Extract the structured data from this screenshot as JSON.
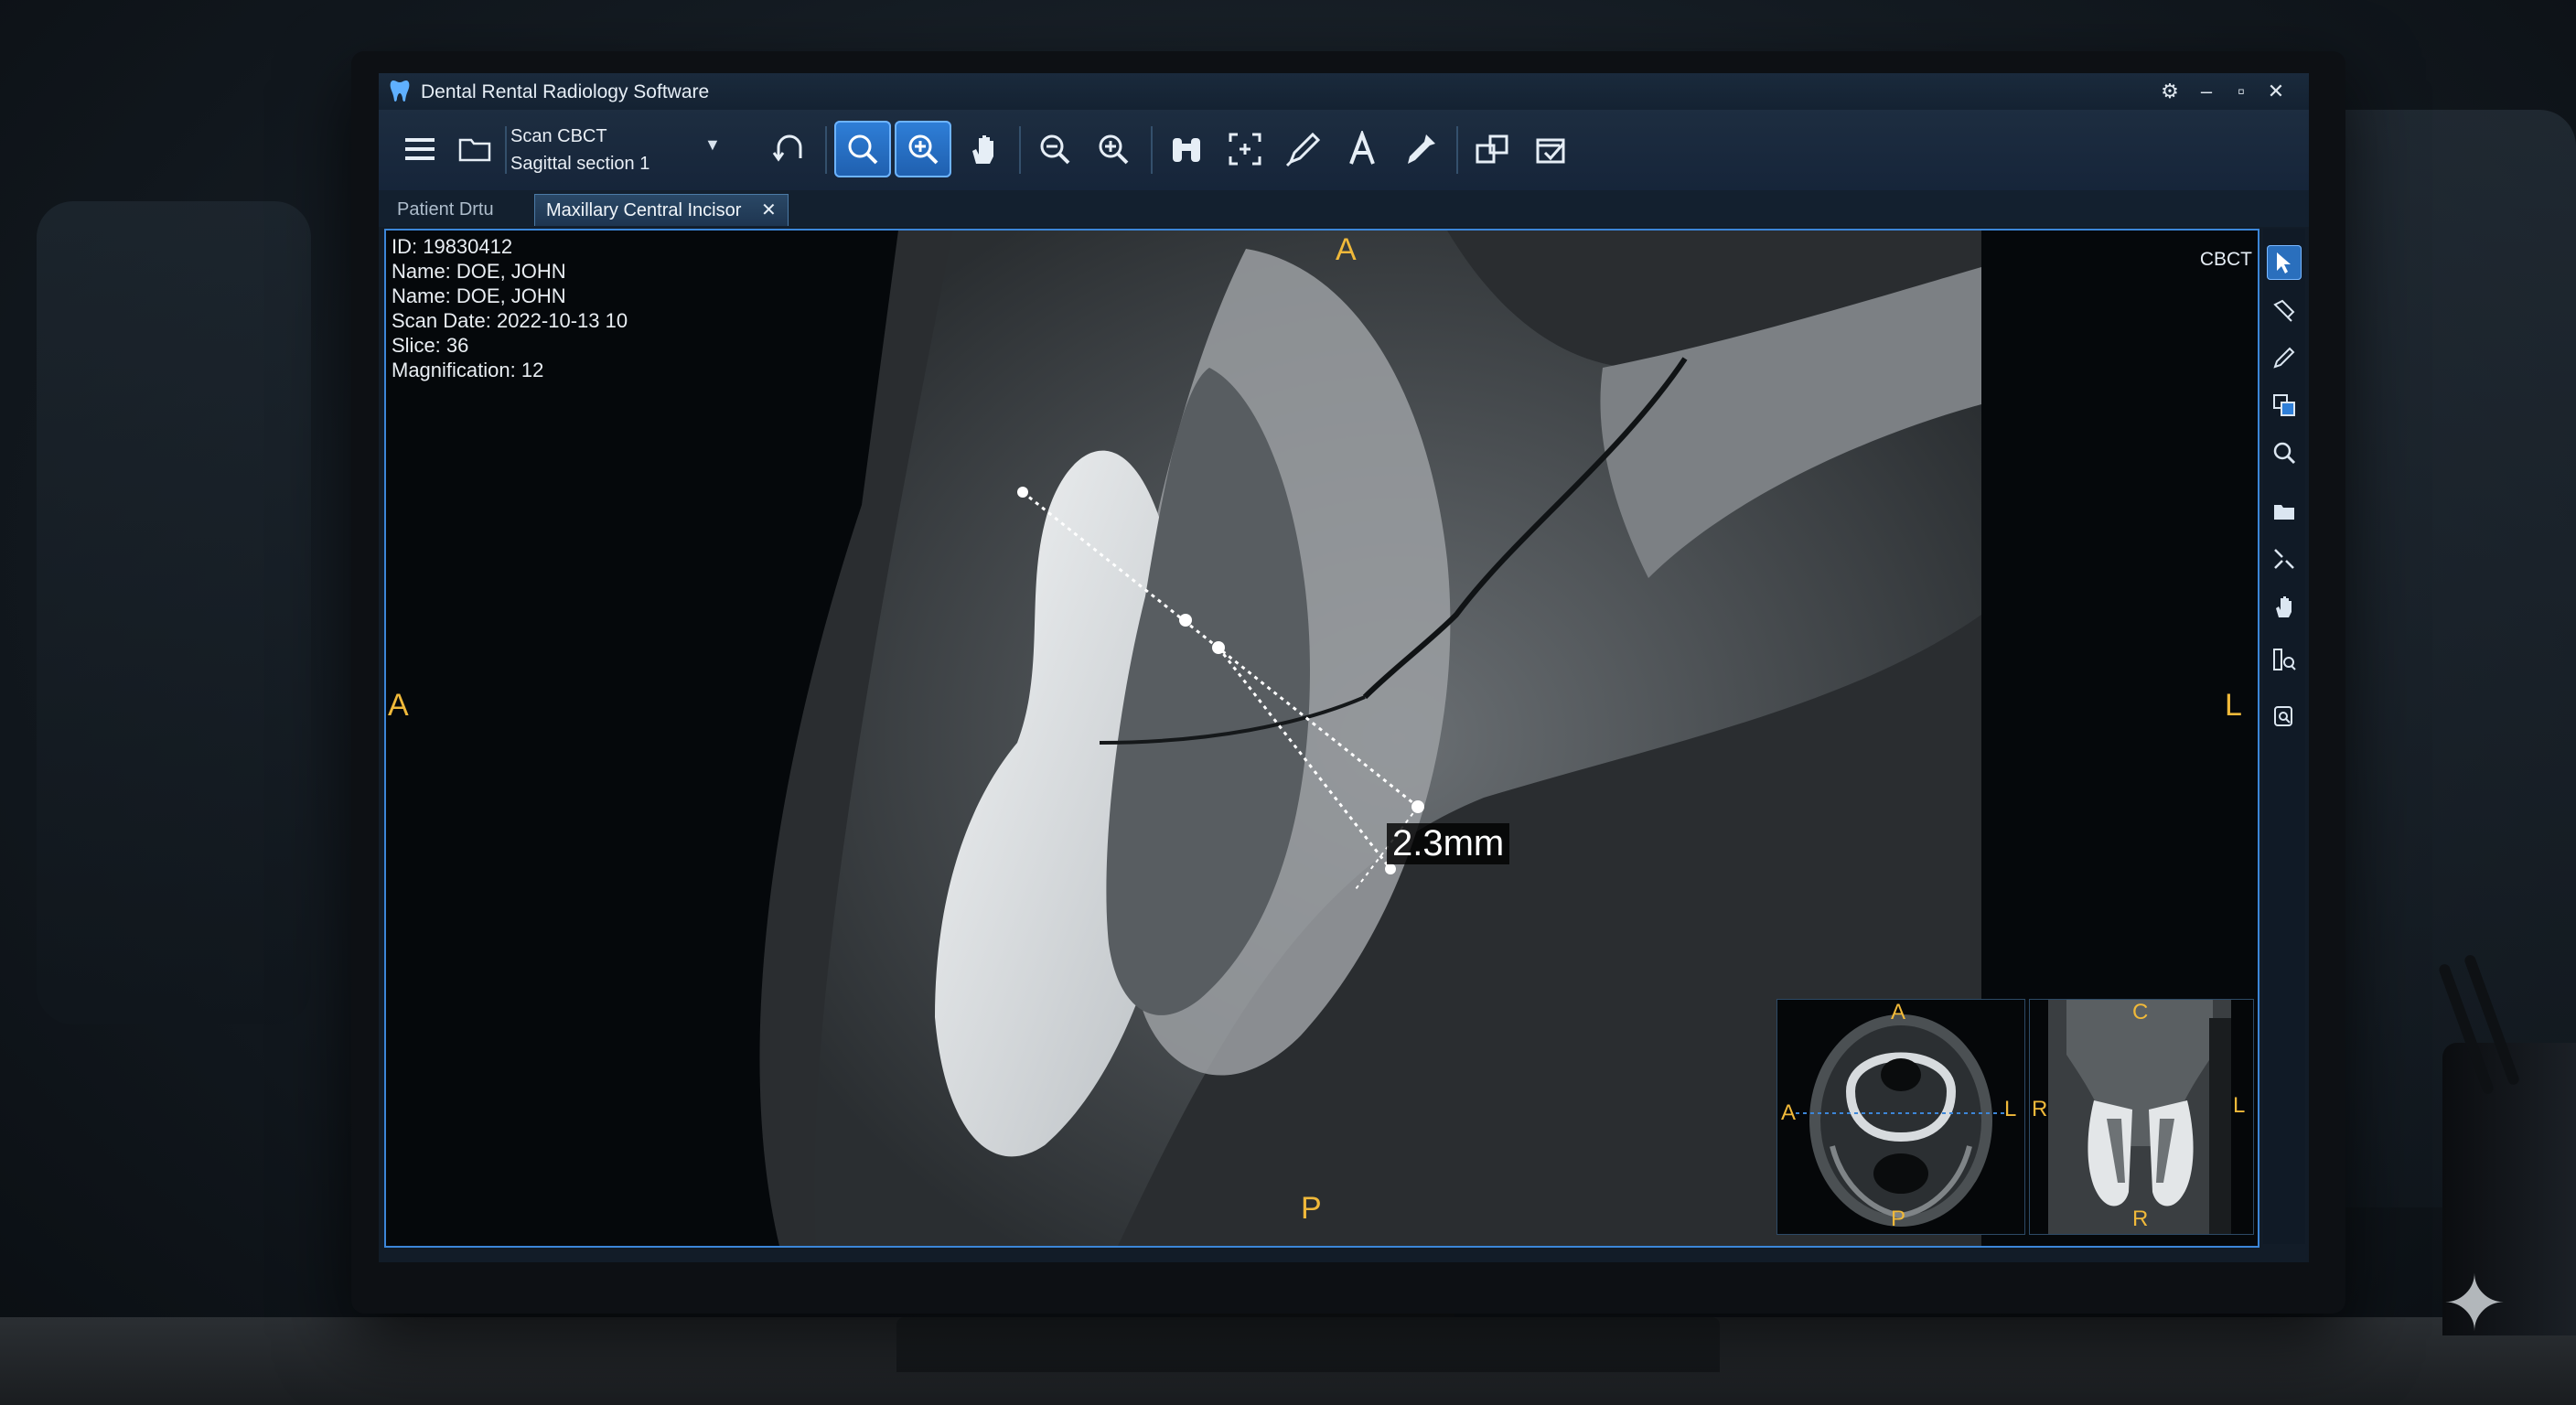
{
  "window": {
    "title": "Dental Rental Radiology Software"
  },
  "toolbar": {
    "scan_select": {
      "line1": "Scan CBCT",
      "line2": "Sagittal section 1"
    }
  },
  "tabs": [
    {
      "label": "Patient Drtu",
      "active": false
    },
    {
      "label": "Maxillary Central Incisor",
      "active": true,
      "closable": true
    }
  ],
  "patient_info": {
    "id": "ID: 19830412",
    "name1": "Name: DOE, JOHN",
    "name2": "Name: DOE, JOHN",
    "scan_date": "Scan Date: 2022-10-13 10",
    "slice": "Slice: 36",
    "magnification": "Magnification: 12"
  },
  "viewport": {
    "modality": "CBCT",
    "orientation": {
      "top": "A",
      "left": "A",
      "right": "L",
      "bottom": "P"
    },
    "measurement": "2.3mm"
  },
  "inset_axial": {
    "top": "A",
    "left": "A",
    "right": "L",
    "bottom": "P"
  },
  "inset_coronal": {
    "top": "C",
    "left": "R",
    "right": "L",
    "bottom": "R"
  },
  "icons": {
    "toolbar": [
      "menu-icon",
      "folder-icon",
      "undo-icon",
      "zoom-icon",
      "zoom-in-active-icon",
      "pan-hand-icon",
      "zoom-out-icon",
      "zoom-in-icon",
      "binoculars-icon",
      "crop-icon",
      "ruler-pen-icon",
      "text-icon",
      "pipette-icon",
      "layout-icon",
      "print-icon"
    ],
    "right": [
      "pointer-icon",
      "pen-tool-icon",
      "pencil-icon",
      "copy-layers-icon",
      "magnify-icon",
      "folder-icon",
      "transform-icon",
      "hand-icon",
      "measure-zoom-icon",
      "settings-search-icon"
    ]
  },
  "colors": {
    "accent": "#2f7fd8",
    "orientation_label": "#f0b93a",
    "viewport_border": "#3c86d8"
  }
}
